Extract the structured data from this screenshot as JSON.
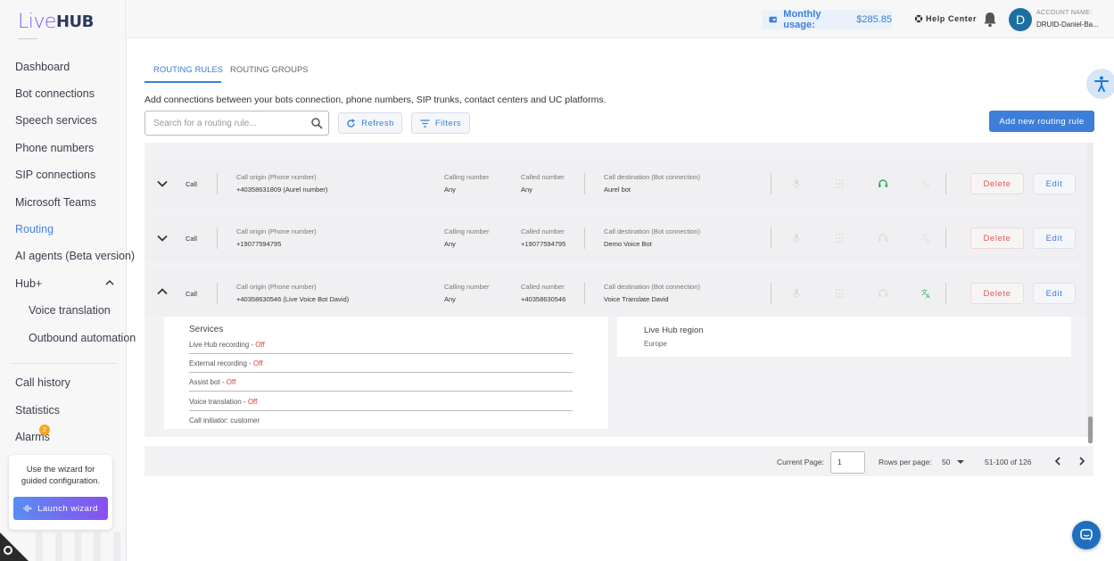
{
  "brand": {
    "logo_text_1": "Live",
    "logo_text_2": "HUB"
  },
  "sidebar": {
    "items": [
      {
        "label": "Dashboard"
      },
      {
        "label": "Bot connections"
      },
      {
        "label": "Speech services"
      },
      {
        "label": "Phone numbers"
      },
      {
        "label": "SIP connections"
      },
      {
        "label": "Microsoft Teams"
      },
      {
        "label": "Routing",
        "active": true
      },
      {
        "label": "AI agents (Beta version)"
      },
      {
        "label": "Hub+"
      },
      {
        "label": "Voice translation"
      },
      {
        "label": "Outbound automation"
      },
      {
        "label": "Call history"
      },
      {
        "label": "Statistics"
      },
      {
        "label": "Alarms"
      }
    ],
    "alarm_count": "2",
    "wizard": {
      "text": "Use the wizard for guided configuration.",
      "button": "Launch wizard"
    }
  },
  "header": {
    "usage_label": "Monthly usage:",
    "usage_value": "$285.85",
    "help": "Help Center",
    "avatar_initial": "D",
    "account_label": "ACCOUNT NAME:",
    "account_name": "DRUID-Daniel-Ba..."
  },
  "tabs": [
    {
      "label": "ROUTING RULES",
      "active": true
    },
    {
      "label": "ROUTING GROUPS"
    }
  ],
  "description": "Add connections between your bots connection, phone numbers, SIP trunks, contact centers and UC platforms.",
  "toolbar": {
    "search_placeholder": "Search for a routing rule...",
    "refresh": "Refresh",
    "filters": "Filters",
    "add_new": "Add new routing rule"
  },
  "columns": {
    "origin": "Call origin (Phone number)",
    "calling": "Calling number",
    "called": "Called number",
    "destination": "Call destination (Bot connection)"
  },
  "rows": [
    {
      "type": "Call",
      "origin": "+40358631809 (Aurel number)",
      "calling": "Any",
      "called": "Any",
      "destination": "Aurel bot",
      "delete": "Delete",
      "edit": "Edit"
    },
    {
      "type": "Call",
      "origin": "+19077594795",
      "calling": "Any",
      "called": "+19077594795",
      "destination": "Demo Voice Bot",
      "delete": "Delete",
      "edit": "Edit"
    },
    {
      "type": "Call",
      "origin": "+40358630546 (Live Voice Bot David)",
      "calling": "Any",
      "called": "+40358630546",
      "destination": "Voice Translate David",
      "delete": "Delete",
      "edit": "Edit"
    }
  ],
  "services": {
    "title": "Services",
    "items": [
      {
        "name": "Live Hub recording - ",
        "status": "Off"
      },
      {
        "name": "External recording - ",
        "status": "Off"
      },
      {
        "name": "Assist bot - ",
        "status": "Off"
      },
      {
        "name": "Voice translation - ",
        "status": "Off"
      }
    ],
    "initiator": "Call initiator: customer"
  },
  "region": {
    "title": "Live Hub region",
    "value": "Europe"
  },
  "pagination": {
    "current_page_label": "Current Page:",
    "current_page": "1",
    "rows_per_page_label": "Rows per page:",
    "rows_per_page": "50",
    "range": "51-100 of 126"
  },
  "colors": {
    "accent": "#3d7ed8",
    "danger": "#e05a5a",
    "brand": "#7a5cff",
    "green": "#27ae60"
  }
}
